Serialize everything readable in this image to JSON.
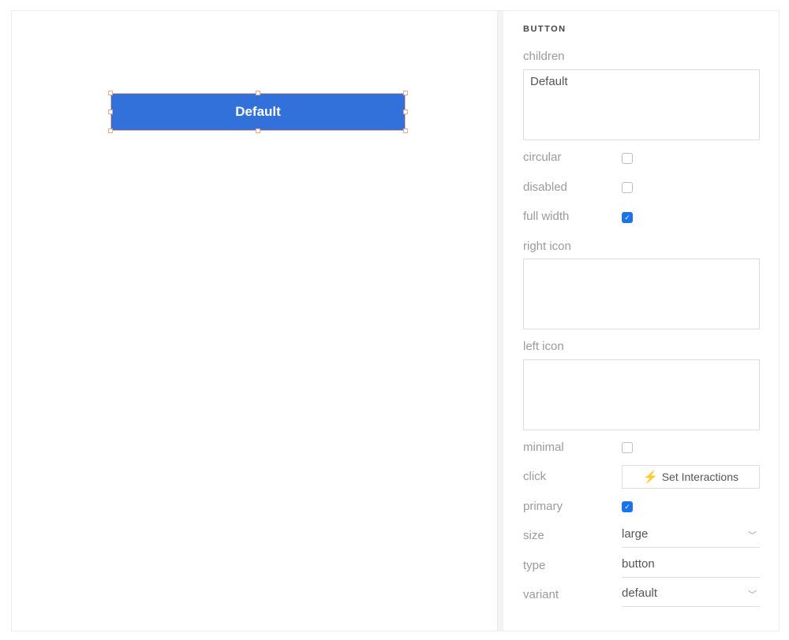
{
  "canvas": {
    "preview_button": {
      "label": "Default",
      "color": "#3171d9"
    }
  },
  "panel": {
    "section_title": "BUTTON",
    "children": {
      "label": "children",
      "value": "Default"
    },
    "circular": {
      "label": "circular",
      "checked": false
    },
    "disabled": {
      "label": "disabled",
      "checked": false
    },
    "full_width": {
      "label": "full width",
      "checked": true
    },
    "right_icon": {
      "label": "right icon",
      "value": ""
    },
    "left_icon": {
      "label": "left icon",
      "value": ""
    },
    "minimal": {
      "label": "minimal",
      "checked": false
    },
    "click": {
      "label": "click",
      "button_label": "Set Interactions",
      "icon": "lightning-bolt-icon"
    },
    "primary": {
      "label": "primary",
      "checked": true
    },
    "size": {
      "label": "size",
      "value": "large",
      "icon": "chevron-down-icon"
    },
    "type": {
      "label": "type",
      "value": "button"
    },
    "variant": {
      "label": "variant",
      "value": "default",
      "icon": "chevron-down-icon"
    },
    "check_glyph": "✓",
    "accent_color": "#1a73e8"
  }
}
